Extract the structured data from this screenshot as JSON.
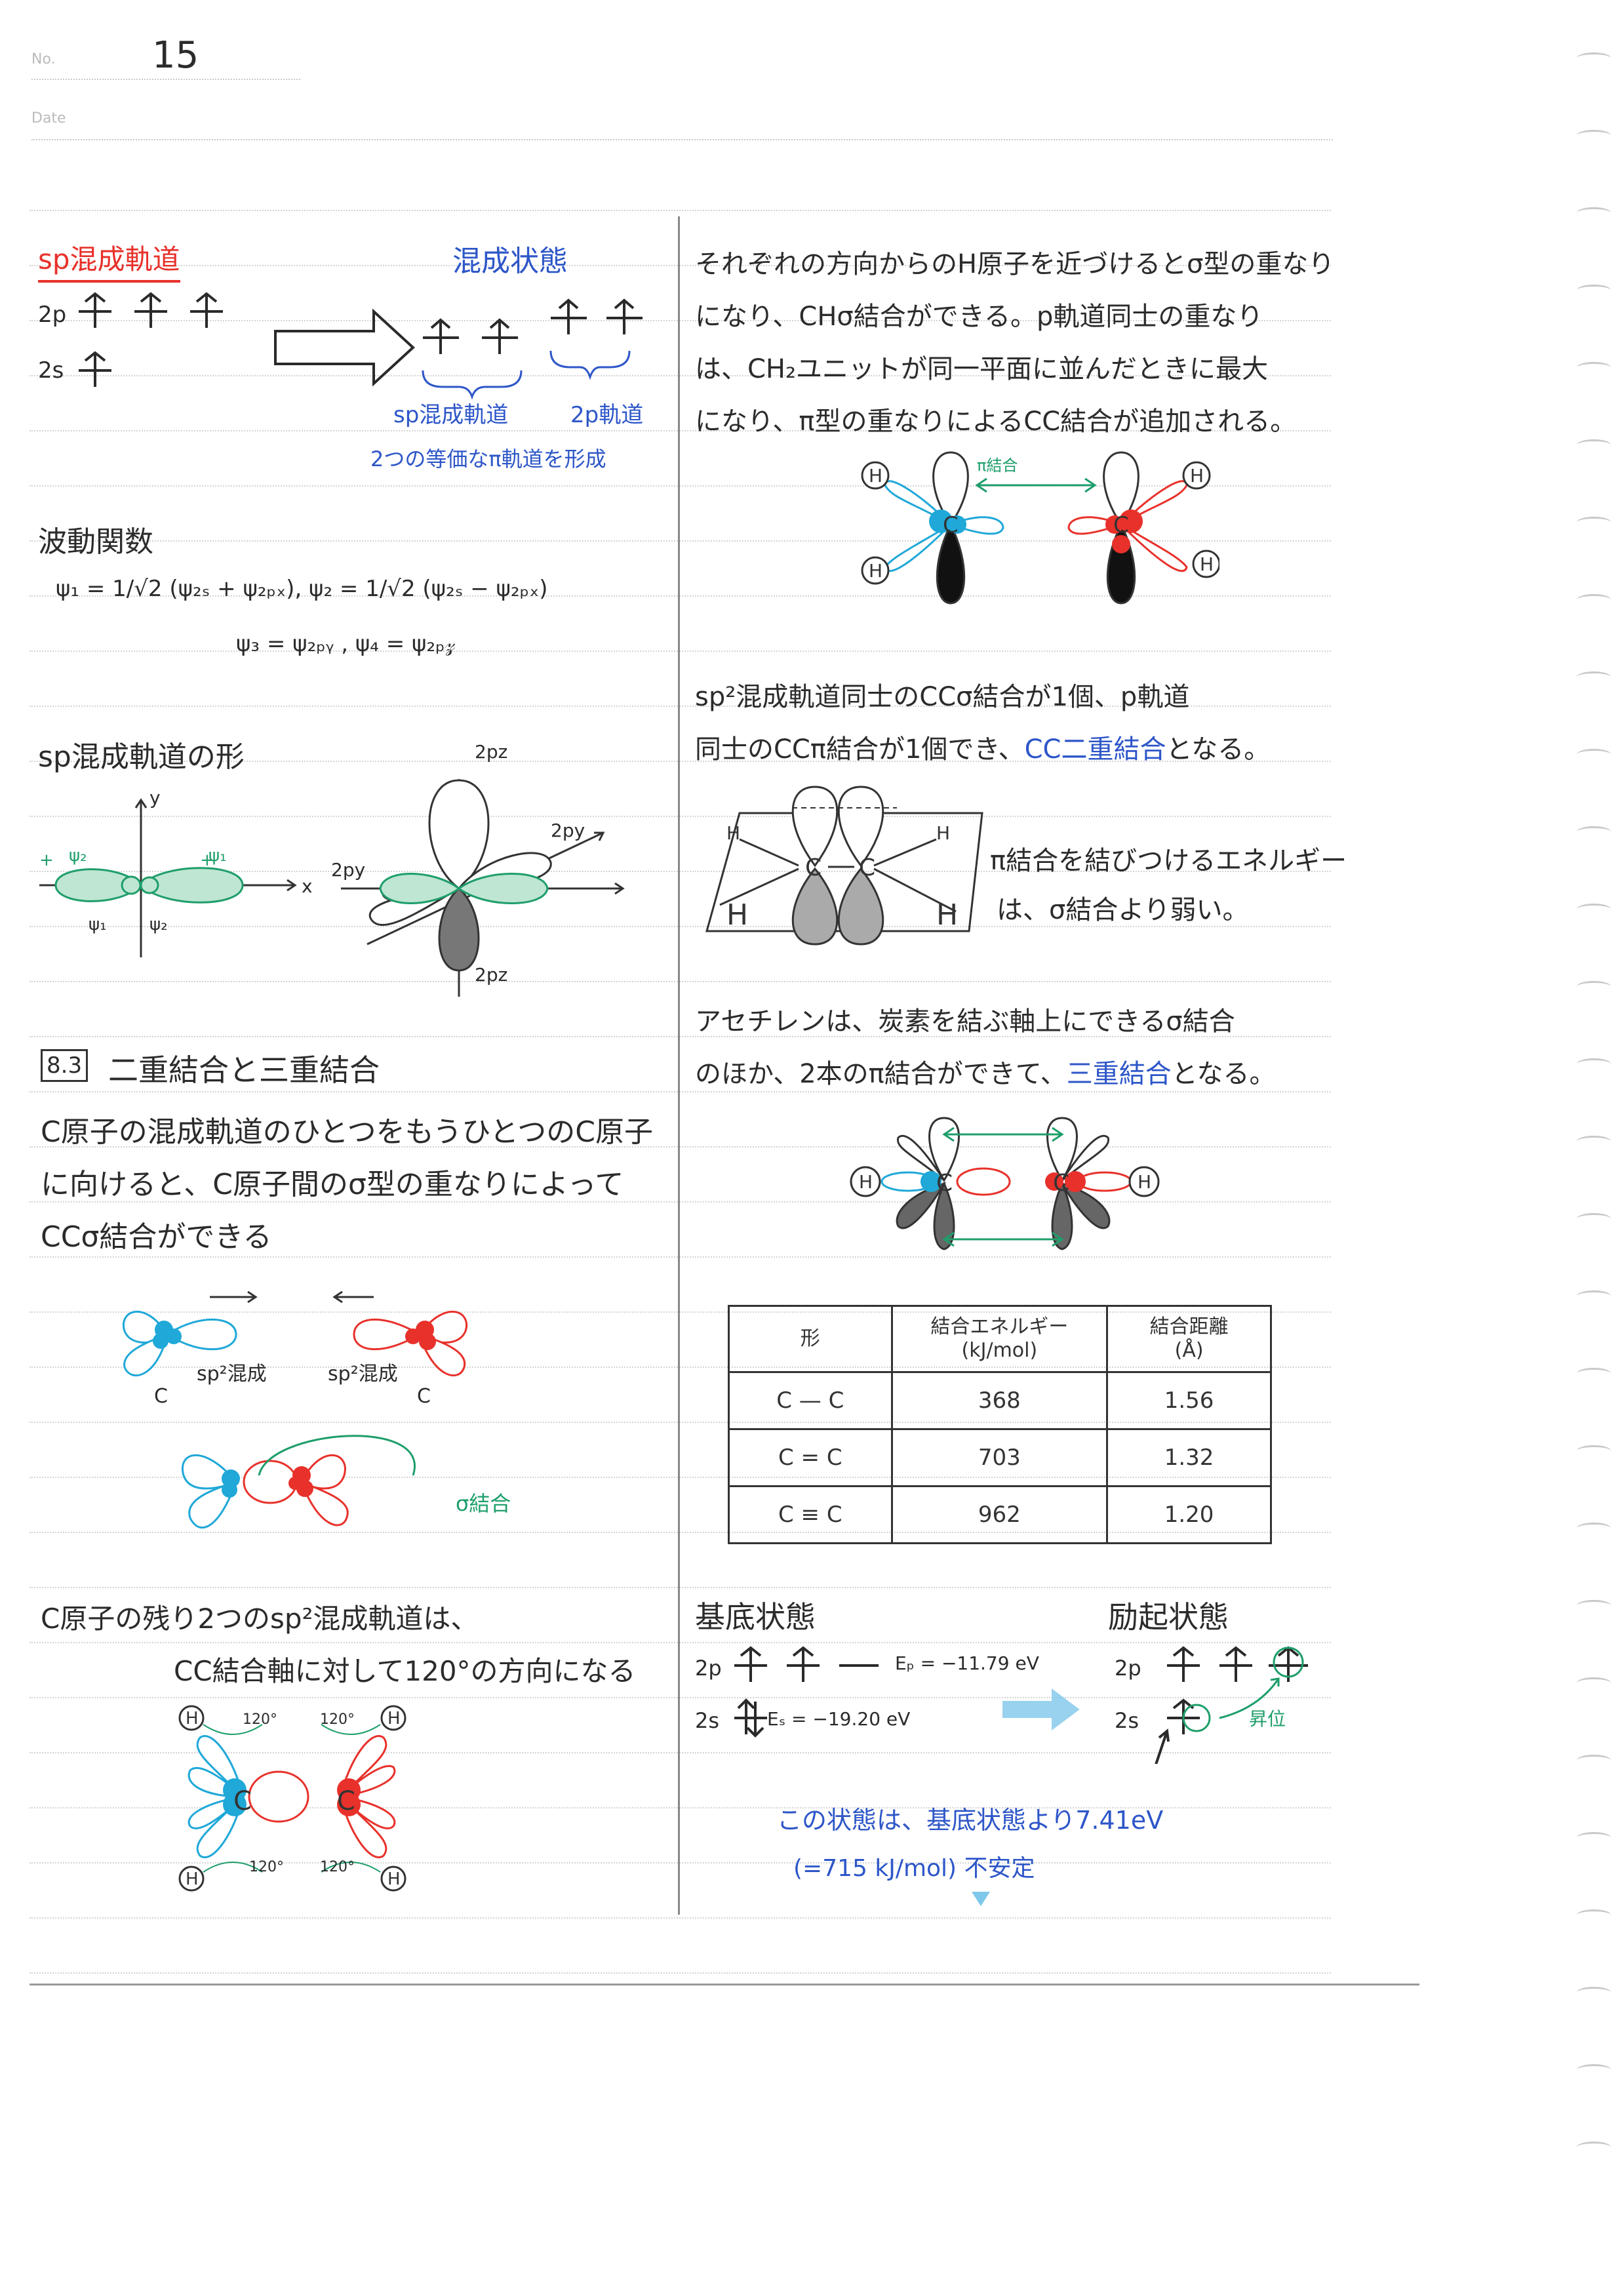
{
  "header": {
    "no_label": "No.",
    "page_no": "15",
    "date_label": "Date"
  },
  "left": {
    "sp_title": "sp混成軌道",
    "hybrid_state_label": "混成状態",
    "ground_labels": {
      "p2": "2p",
      "s2": "2s"
    },
    "sp_hybrid_label": "sp混成軌道",
    "p2_orbital_label": "2p軌道",
    "pi_note": "2つの等価なπ軌道を形成",
    "wave_title": "波動関数",
    "wave_eq1": "ψ₁ = 1/√2 (ψ₂ₛ + ψ₂ₚₓ),  ψ₂ = 1/√2 (ψ₂ₛ − ψ₂ₚₓ)",
    "wave_eq2": "ψ₃ = ψ₂ₚᵧ ,  ψ₄ = ψ₂ₚ𝓏",
    "shape_title": "sp混成軌道の形",
    "axis_labels": {
      "y": "y",
      "x": "x",
      "psi1": "ψ₁",
      "psi2": "ψ₂",
      "p2z": "2pz",
      "p2y": "2py",
      "p2y_left": "2py",
      "p2z_bottom": "2pz"
    },
    "section_num": "8.3",
    "section_title": "二重結合と三重結合",
    "para1": [
      "C原子の混成軌道のひとつをもうひとつのC原子",
      "に向けると、C原子間のσ型の重なりによって",
      "CCσ結合ができる"
    ],
    "sp2_label_a": "sp²混成",
    "sp2_label_b": "sp²混成",
    "c_label": "C",
    "sigma_bond_label": "σ結合",
    "para2": [
      "C原子の残り2つのsp²混成軌道は、",
      "CC結合軸に対して120°の方向になる"
    ],
    "angle_label": "120°",
    "h_label": "H",
    "sigma": "σ"
  },
  "right": {
    "para1": [
      "それぞれの方向からのH原子を近づけるとσ型の重なり",
      "になり、CHσ結合ができる。p軌道同士の重なり",
      "は、CH₂ユニットが同一平面に並んだときに最大",
      "になり、π型の重なりによるCC結合が追加される。"
    ],
    "pi_bond_label": "π結合",
    "para2_a": "sp²混成軌道同士のCCσ結合が1個、p軌道",
    "para2_b": "同士のCCπ結合が1個でき、",
    "para2_blue": "CC二重結合",
    "para2_c": "となる。",
    "pi_energy": [
      "π結合を結びつけるエネルギー",
      "は、σ結合より弱い。"
    ],
    "para3_a": "アセチレンは、炭素を結ぶ軸上にできるσ結合",
    "para3_b": "のほか、2本のπ結合ができて、",
    "para3_blue": "三重結合",
    "para3_c": "となる。",
    "table": {
      "headers": [
        "形",
        "結合エネルギー\n(kJ/mol)",
        "結合距離\n(Å)"
      ],
      "rows": [
        {
          "shape": "C — C",
          "energy": "368",
          "length": "1.56"
        },
        {
          "shape": "C = C",
          "energy": "703",
          "length": "1.32"
        },
        {
          "shape": "C ≡ C",
          "energy": "962",
          "length": "1.20"
        }
      ]
    },
    "ground_title": "基底状態",
    "excited_title": "励起状態",
    "ep": "Eₚ = −11.79 eV",
    "es": "Eₛ = −19.20 eV",
    "promote": "昇位",
    "note_a": "この状態は、基底状態より7.41eV",
    "note_b": "(=715 kJ/mol) 不安定"
  },
  "colors": {
    "cyan": "#1fa8d8",
    "red": "#e8312b",
    "green": "#1e9e6a",
    "blue": "#2d56c8",
    "gray": "#555555"
  }
}
